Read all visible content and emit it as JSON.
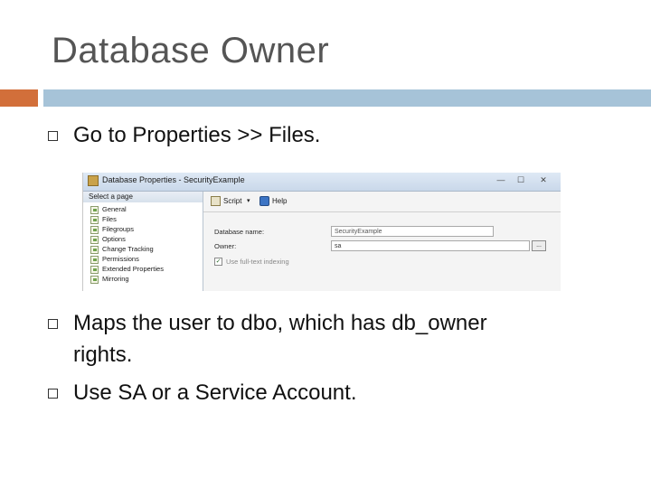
{
  "slide": {
    "title": "Database Owner",
    "bullets": [
      "Go to Properties >> Files.",
      "Maps the user to dbo, which has db_owner",
      "rights.",
      "Use SA or a Service Account."
    ]
  },
  "screenshot": {
    "window_title": "Database Properties - SecurityExample",
    "select_page_header": "Select a page",
    "pages": [
      "General",
      "Files",
      "Filegroups",
      "Options",
      "Change Tracking",
      "Permissions",
      "Extended Properties",
      "Mirroring"
    ],
    "toolbar": {
      "script_label": "Script",
      "help_label": "Help",
      "script_icon": "script-icon",
      "help_icon": "help-icon"
    },
    "fields": {
      "database_name_label": "Database name:",
      "database_name_value": "SecurityExample",
      "owner_label": "Owner:",
      "owner_value": "sa",
      "browse_label": "...",
      "fulltext_label": "Use full-text indexing",
      "fulltext_checked": true
    },
    "window_buttons": [
      "—",
      "☐",
      "✕"
    ]
  },
  "colors": {
    "accent_orange": "#d26f3a",
    "accent_blue": "#a6c3d8",
    "title_gray": "#555555"
  }
}
